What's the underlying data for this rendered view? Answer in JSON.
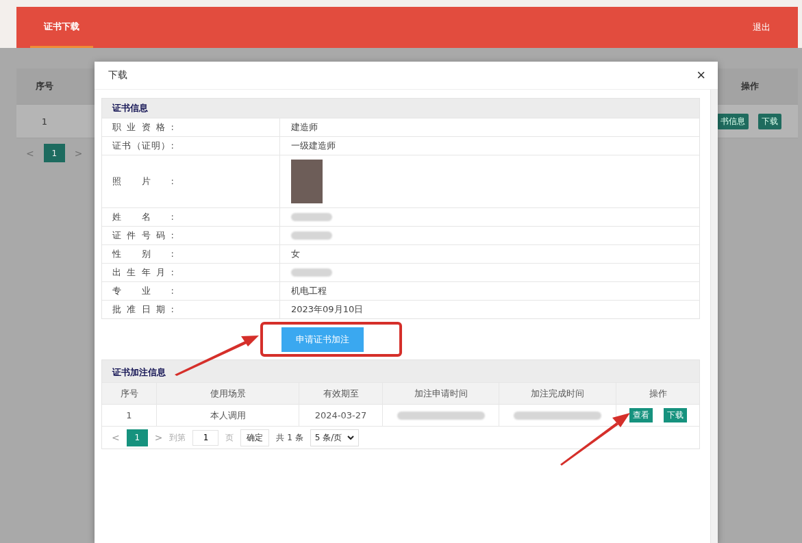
{
  "header": {
    "tabs": [
      {
        "label": "证书下载",
        "selected": true
      }
    ],
    "logout": "退出"
  },
  "background_table": {
    "columns": [
      "序号",
      "操作"
    ],
    "rows": [
      {
        "index": "1",
        "actions": [
          "书信息",
          "下载"
        ]
      }
    ],
    "pagination": {
      "prev": "<",
      "pages": [
        {
          "label": "1",
          "selected": true
        }
      ],
      "next": ">"
    }
  },
  "dialog": {
    "title": "下载",
    "close": "×",
    "cert_info": {
      "heading": "证书信息",
      "fields": [
        {
          "kind": "text",
          "label": "职业资格:",
          "value": "建造师"
        },
        {
          "kind": "text",
          "label": "证书（证明）:",
          "value": "一级建造师"
        },
        {
          "kind": "photo",
          "label": "照片:"
        },
        {
          "kind": "redacted",
          "label": "姓名:"
        },
        {
          "kind": "redacted",
          "label": "证件号码:"
        },
        {
          "kind": "text",
          "label": "性别:",
          "value": "女"
        },
        {
          "kind": "redacted",
          "label": "出生年月:"
        },
        {
          "kind": "text",
          "label": "专业:",
          "value": "机电工程"
        },
        {
          "kind": "text",
          "label": "批准日期:",
          "value": "2023年09月10日"
        }
      ]
    },
    "apply_button": "申请证书加注",
    "annotation_info": {
      "heading": "证书加注信息",
      "columns": [
        "序号",
        "使用场景",
        "有效期至",
        "加注申请时间",
        "加注完成时间",
        "操作"
      ],
      "rows": [
        {
          "cells": [
            {
              "kind": "text",
              "text": "1"
            },
            {
              "kind": "text",
              "text": "本人调用"
            },
            {
              "kind": "text",
              "text": "2024-03-27"
            },
            {
              "kind": "redacted"
            },
            {
              "kind": "redacted"
            }
          ],
          "actions": [
            "查看",
            "下载"
          ]
        }
      ],
      "pagination": {
        "prev": "<",
        "pages": [
          {
            "label": "1",
            "selected": true
          }
        ],
        "next": ">",
        "goto_label": "到第",
        "page_input": "1",
        "page_unit": "页",
        "confirm": "确定",
        "total": "共 1 条",
        "page_size": "5 条/页"
      }
    }
  }
}
